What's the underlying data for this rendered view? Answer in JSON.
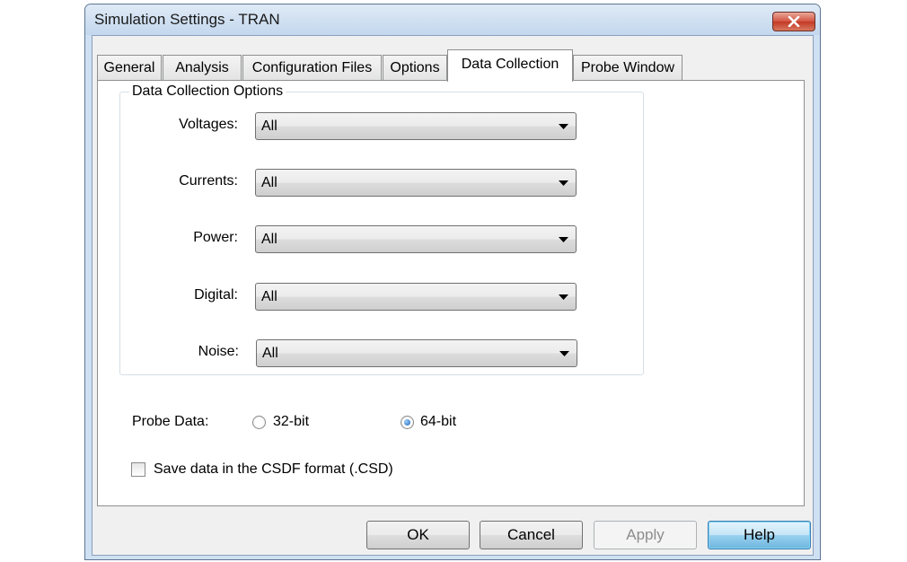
{
  "window": {
    "title": "Simulation Settings - TRAN"
  },
  "tabs": [
    {
      "label": "General"
    },
    {
      "label": "Analysis"
    },
    {
      "label": "Configuration Files"
    },
    {
      "label": "Options"
    },
    {
      "label": "Data Collection",
      "active": true
    },
    {
      "label": "Probe Window"
    }
  ],
  "data_collection": {
    "group_title": "Data Collection Options",
    "rows": [
      {
        "label": "Voltages:",
        "value": "All"
      },
      {
        "label": "Currents:",
        "value": "All"
      },
      {
        "label": "Power:",
        "value": "All"
      },
      {
        "label": "Digital:",
        "value": "All"
      },
      {
        "label": "Noise:",
        "value": "All"
      }
    ]
  },
  "probe_data": {
    "label": "Probe Data:",
    "options": [
      {
        "label": "32-bit",
        "selected": false
      },
      {
        "label": "64-bit",
        "selected": true
      }
    ]
  },
  "save_csdf": {
    "label": "Save data in the CSDF format (.CSD)",
    "checked": false
  },
  "buttons": {
    "ok": "OK",
    "cancel": "Cancel",
    "apply": "Apply",
    "help": "Help"
  },
  "colors": {
    "accent": "#3c7fb1",
    "close": "#c23a26",
    "disabled_text": "#8d8d8d"
  }
}
